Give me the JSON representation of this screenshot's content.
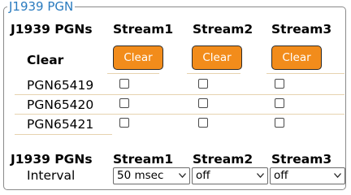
{
  "fieldset": {
    "legend": "J1939 PGN"
  },
  "clear_section": {
    "header": [
      "J1939 PGNs",
      "Stream1",
      "Stream2",
      "Stream3"
    ],
    "clear_label": "Clear",
    "clear_buttons": [
      "Clear",
      "Clear",
      "Clear"
    ],
    "rows": [
      {
        "pgn": "PGN65419",
        "checked": [
          false,
          false,
          false
        ]
      },
      {
        "pgn": "PGN65420",
        "checked": [
          false,
          false,
          false
        ]
      },
      {
        "pgn": "PGN65421",
        "checked": [
          false,
          false,
          false
        ]
      }
    ]
  },
  "interval_section": {
    "header": [
      "J1939 PGNs",
      "Stream1",
      "Stream2",
      "Stream3"
    ],
    "interval_label": "Interval",
    "selects": [
      {
        "value": "50 msec"
      },
      {
        "value": "off"
      },
      {
        "value": "off"
      }
    ]
  },
  "colors": {
    "legend": "#2a7bbf",
    "button_fill": "#f28c1b",
    "button_text": "#ffffff",
    "divider": "#e6d3b0"
  }
}
